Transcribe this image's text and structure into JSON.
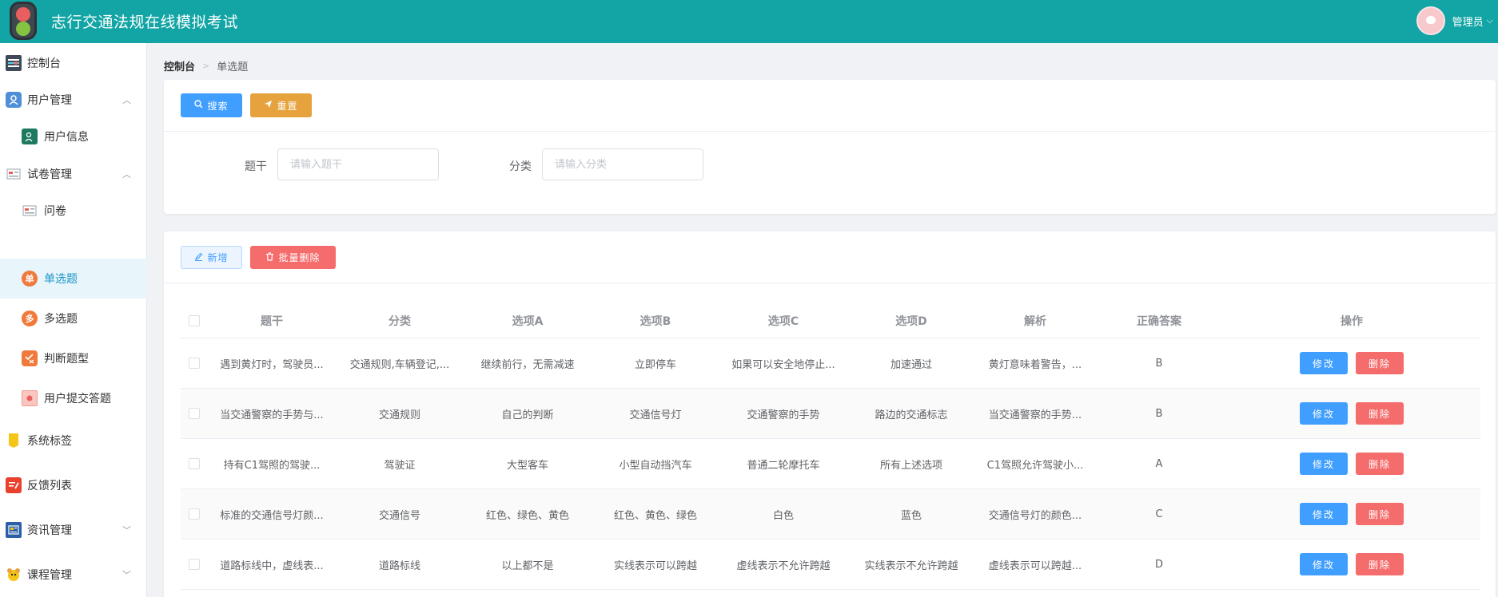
{
  "header": {
    "title": "志行交通法规在线模拟考试",
    "username": "管理员"
  },
  "sidebar": {
    "items": [
      {
        "label": "控制台",
        "icon": "dashboard-icon"
      },
      {
        "label": "用户管理",
        "icon": "users-icon",
        "expanded": true
      },
      {
        "label": "用户信息",
        "icon": "user-info-icon",
        "sub": true
      },
      {
        "label": "试卷管理",
        "icon": "paper-icon",
        "expanded": true
      },
      {
        "label": "问卷",
        "icon": "questionnaire-icon",
        "sub": true
      },
      {
        "label": "单选题",
        "icon": "single-choice-icon",
        "sub": true,
        "active": true,
        "glyph": "单"
      },
      {
        "label": "多选题",
        "icon": "multi-choice-icon",
        "sub": true,
        "glyph": "多"
      },
      {
        "label": "判断题型",
        "icon": "judge-icon",
        "sub": true
      },
      {
        "label": "用户提交答题",
        "icon": "submission-icon",
        "sub": true
      },
      {
        "label": "系统标签",
        "icon": "tag-icon"
      },
      {
        "label": "反馈列表",
        "icon": "feedback-icon"
      },
      {
        "label": "资讯管理",
        "icon": "news-icon",
        "expanded": false
      },
      {
        "label": "课程管理",
        "icon": "course-icon",
        "expanded": false
      }
    ]
  },
  "breadcrumb": {
    "home": "控制台",
    "current": "单选题"
  },
  "search": {
    "search_label": "搜索",
    "reset_label": "重置",
    "stem_label": "题干",
    "stem_placeholder": "请输入题干",
    "category_label": "分类",
    "category_placeholder": "请输入分类"
  },
  "toolbar": {
    "add_label": "新增",
    "batch_delete_label": "批量删除"
  },
  "table": {
    "columns": [
      "题干",
      "分类",
      "选项A",
      "选项B",
      "选项C",
      "选项D",
      "解析",
      "正确答案",
      "操作"
    ],
    "edit_label": "修改",
    "delete_label": "删除",
    "rows": [
      [
        "遇到黄灯时，驾驶员...",
        "交通规则,车辆登记,...",
        "继续前行，无需减速",
        "立即停车",
        "如果可以安全地停止...",
        "加速通过",
        "黄灯意味着警告，...",
        "B"
      ],
      [
        "当交通警察的手势与...",
        "交通规则",
        "自己的判断",
        "交通信号灯",
        "交通警察的手势",
        "路边的交通标志",
        "当交通警察的手势...",
        "B"
      ],
      [
        "持有C1驾照的驾驶...",
        "驾驶证",
        "大型客车",
        "小型自动挡汽车",
        "普通二轮摩托车",
        "所有上述选项",
        "C1驾照允许驾驶小...",
        "A"
      ],
      [
        "标准的交通信号灯颜...",
        "交通信号",
        "红色、绿色、黄色",
        "红色、黄色、绿色",
        "白色",
        "蓝色",
        "交通信号灯的颜色...",
        "C"
      ],
      [
        "道路标线中，虚线表...",
        "道路标线",
        "以上都不是",
        "实线表示可以跨越",
        "虚线表示不允许跨越",
        "实线表示不允许跨越",
        "虚线表示可以跨越...",
        "D"
      ]
    ]
  },
  "colors": {
    "header_bg": "#13a5a5",
    "primary": "#409eff",
    "warning": "#e6a23c",
    "danger": "#f56c6c",
    "active_menu": "#1d96c8"
  }
}
